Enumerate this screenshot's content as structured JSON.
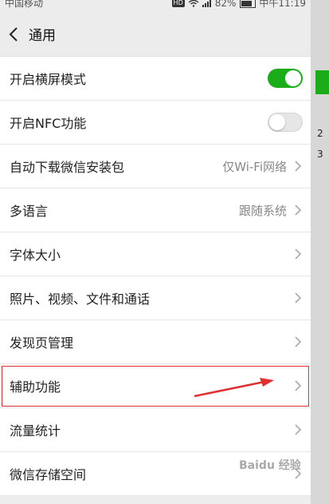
{
  "status_bar": {
    "carrier": "中国移动",
    "battery": "82%",
    "time": "中午11:19",
    "hd_badge": "HD"
  },
  "header": {
    "title": "通用"
  },
  "settings": [
    {
      "label": "开启横屏模式",
      "toggle": true
    },
    {
      "label": "开启NFC功能",
      "toggle": false
    },
    {
      "label": "自动下载微信安装包",
      "value": "仅Wi-Fi网络"
    },
    {
      "label": "多语言",
      "value": "跟随系统"
    },
    {
      "label": "字体大小"
    },
    {
      "label": "照片、视频、文件和通话"
    },
    {
      "label": "发现页管理"
    },
    {
      "label": "辅助功能"
    },
    {
      "label": "流量统计"
    },
    {
      "label": "微信存储空间"
    }
  ],
  "background_app": {
    "text_1": "2",
    "text_2": "3"
  },
  "watermark": "Baidu 经验",
  "colors": {
    "toggle_on": "#1aad19",
    "annotation": "#e03030"
  }
}
